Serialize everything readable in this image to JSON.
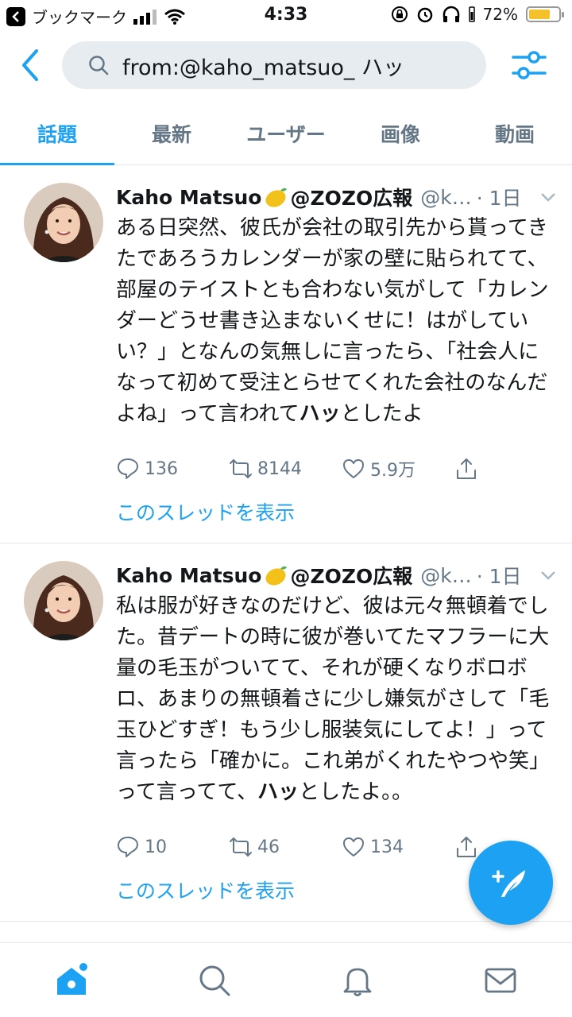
{
  "status_bar": {
    "carrier": "ブックマーク",
    "time": "4:33",
    "battery": "72%",
    "battery_level": 0.72
  },
  "search": {
    "query": "from:@kaho_matsuo_ ハッ"
  },
  "tabs": [
    {
      "label": "話題",
      "active": true
    },
    {
      "label": "最新",
      "active": false
    },
    {
      "label": "ユーザー",
      "active": false
    },
    {
      "label": "画像",
      "active": false
    },
    {
      "label": "動画",
      "active": false
    }
  ],
  "tweets": [
    {
      "name": "Kaho Matsuo",
      "name_suffix": "@ZOZO広報",
      "handle": "@k…",
      "time": "· 1日",
      "text_before": "ある日突然、彼氏が会社の取引先から貰ってきたであろうカレンダーが家の壁に貼られてて、部屋のテイストとも合わない気がして「カレンダーどうせ書き込まないくせに！はがしていい？」となんの気無しに言ったら、「社会人になって初めて受注とらせてくれた会社のなんだよね」って言われて",
      "text_bold": "ハッ",
      "text_after": "としたよ",
      "replies": "136",
      "retweets": "8144",
      "likes": "5.9万",
      "thread_link": "このスレッドを表示"
    },
    {
      "name": "Kaho Matsuo",
      "name_suffix": "@ZOZO広報",
      "handle": "@k…",
      "time": "· 1日",
      "text_before": "私は服が好きなのだけど、彼は元々無頓着でした。昔デートの時に彼が巻いてたマフラーに大量の毛玉がついてて、それが硬くなりボロボロ、あまりの無頓着さに少し嫌気がさして「毛玉ひどすぎ！もう少し服装気にしてよ！」って言ったら「確かに。これ弟がくれたやつや笑」って言ってて、",
      "text_bold": "ハッ",
      "text_after": "としたよ。。",
      "replies": "10",
      "retweets": "46",
      "likes": "134",
      "thread_link": "このスレッドを表示"
    }
  ],
  "bottom_nav": [
    "home",
    "search",
    "notifications",
    "messages"
  ],
  "colors": {
    "accent": "#1da1f2",
    "muted": "#657786",
    "text": "#14171a"
  }
}
